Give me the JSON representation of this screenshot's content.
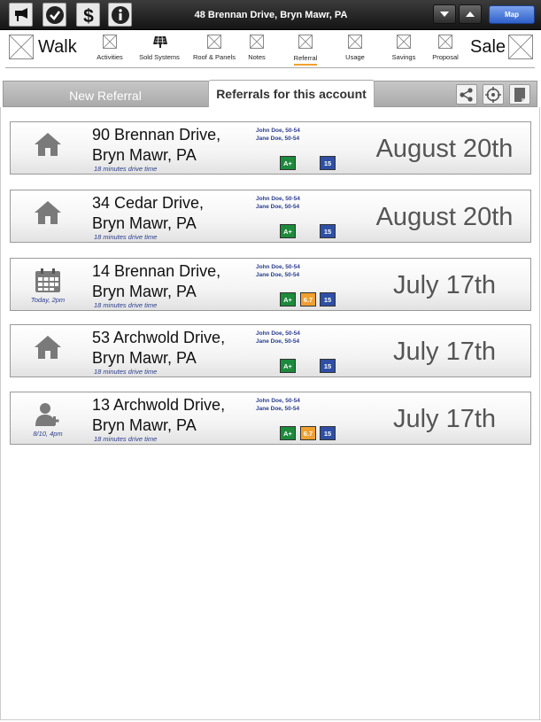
{
  "topbar": {
    "address": "48 Brennan Drive, Bryn Mawr, PA",
    "map_label": "Map",
    "icons": [
      "megaphone-icon",
      "checkmark-icon",
      "dollar-icon",
      "info-icon"
    ]
  },
  "nav": {
    "walk_label": "Walk",
    "sale_label": "Sale",
    "items": [
      {
        "label": "Activities",
        "icon": "placeholder-x-icon"
      },
      {
        "label": "Sold Systems",
        "icon": "solar-panel-icon"
      },
      {
        "label": "Roof & Panels",
        "icon": "placeholder-x-icon"
      },
      {
        "label": "Notes",
        "icon": "placeholder-x-icon"
      },
      {
        "label": "Referral",
        "icon": "placeholder-x-icon",
        "active": true
      },
      {
        "label": "Usage",
        "icon": "placeholder-x-icon"
      },
      {
        "label": "Savings",
        "icon": "placeholder-x-icon"
      },
      {
        "label": "Proposal",
        "icon": "placeholder-x-icon"
      }
    ]
  },
  "tabs": {
    "new_referral": "New Referral",
    "referrals_for_account": "Referrals for this account"
  },
  "referrals": [
    {
      "street": "90 Brennan Drive,",
      "city": "Bryn Mawr, PA",
      "drive_time": "18 minutes drive time",
      "person1": "John Doe, 50-54",
      "person2": "Jane Doe, 50-54",
      "grade": "A+",
      "score": "",
      "count": "15",
      "date": "August 20th",
      "icon": "house-icon",
      "sub": ""
    },
    {
      "street": "34 Cedar Drive,",
      "city": "Bryn Mawr, PA",
      "drive_time": "18 minutes drive time",
      "person1": "John Doe, 50-54",
      "person2": "Jane Doe, 50-54",
      "grade": "A+",
      "score": "",
      "count": "15",
      "date": "August 20th",
      "icon": "house-icon",
      "sub": ""
    },
    {
      "street": "14 Brennan Drive,",
      "city": "Bryn Mawr, PA",
      "drive_time": "18 minutes drive time",
      "person1": "John Doe, 50-54",
      "person2": "Jane Doe, 50-54",
      "grade": "A+",
      "score": "6.7",
      "count": "15",
      "date": "July 17th",
      "icon": "calendar-icon",
      "sub": "Today, 2pm"
    },
    {
      "street": "53 Archwold Drive,",
      "city": "Bryn Mawr, PA",
      "drive_time": "18 minutes drive time",
      "person1": "John Doe, 50-54",
      "person2": "Jane Doe, 50-54",
      "grade": "A+",
      "score": "",
      "count": "15",
      "date": "July 17th",
      "icon": "house-icon",
      "sub": ""
    },
    {
      "street": "13 Archwold Drive,",
      "city": "Bryn Mawr, PA",
      "drive_time": "18 minutes drive time",
      "person1": "John Doe, 50-54",
      "person2": "Jane Doe, 50-54",
      "grade": "A+",
      "score": "6.7",
      "count": "15",
      "date": "July 17th",
      "icon": "add-person-icon",
      "sub": "8/10, 4pm"
    }
  ],
  "colors": {
    "grade_green": "#1d8a3c",
    "score_orange": "#f0a030",
    "count_blue": "#2f4fa5",
    "link_blue": "#2a3d8f",
    "active_underline": "#f0a030"
  }
}
